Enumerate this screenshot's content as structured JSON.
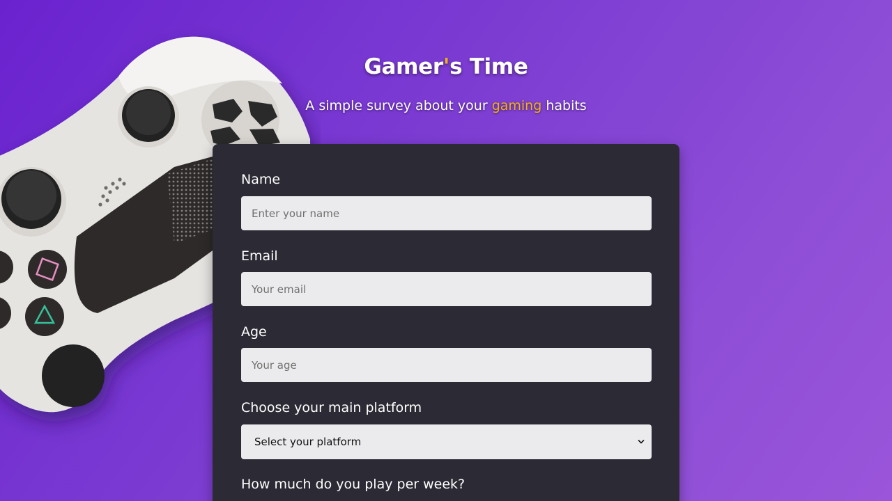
{
  "header": {
    "title_main": "Gamer",
    "title_apostrophe": "'",
    "title_rest": "s Time",
    "subtitle_pre": "A simple survey about your ",
    "subtitle_accent": "gaming",
    "subtitle_post": " habits"
  },
  "form": {
    "name": {
      "label": "Name",
      "placeholder": "Enter your name",
      "value": ""
    },
    "email": {
      "label": "Email",
      "placeholder": "Your email",
      "value": ""
    },
    "age": {
      "label": "Age",
      "placeholder": "Your age",
      "value": ""
    },
    "platform": {
      "label": "Choose your main platform",
      "selected": "Select your platform"
    },
    "weekly": {
      "label": "How much do you play per week?"
    }
  },
  "colors": {
    "accent": "#f2b019",
    "card_bg": "#2c2b35",
    "field_bg": "#ebebed",
    "background_start": "#6a22cf",
    "background_end": "#9a55da"
  },
  "icons": {
    "background_image": "game-controller-illustration",
    "select_chevron": "chevron-down-icon"
  }
}
